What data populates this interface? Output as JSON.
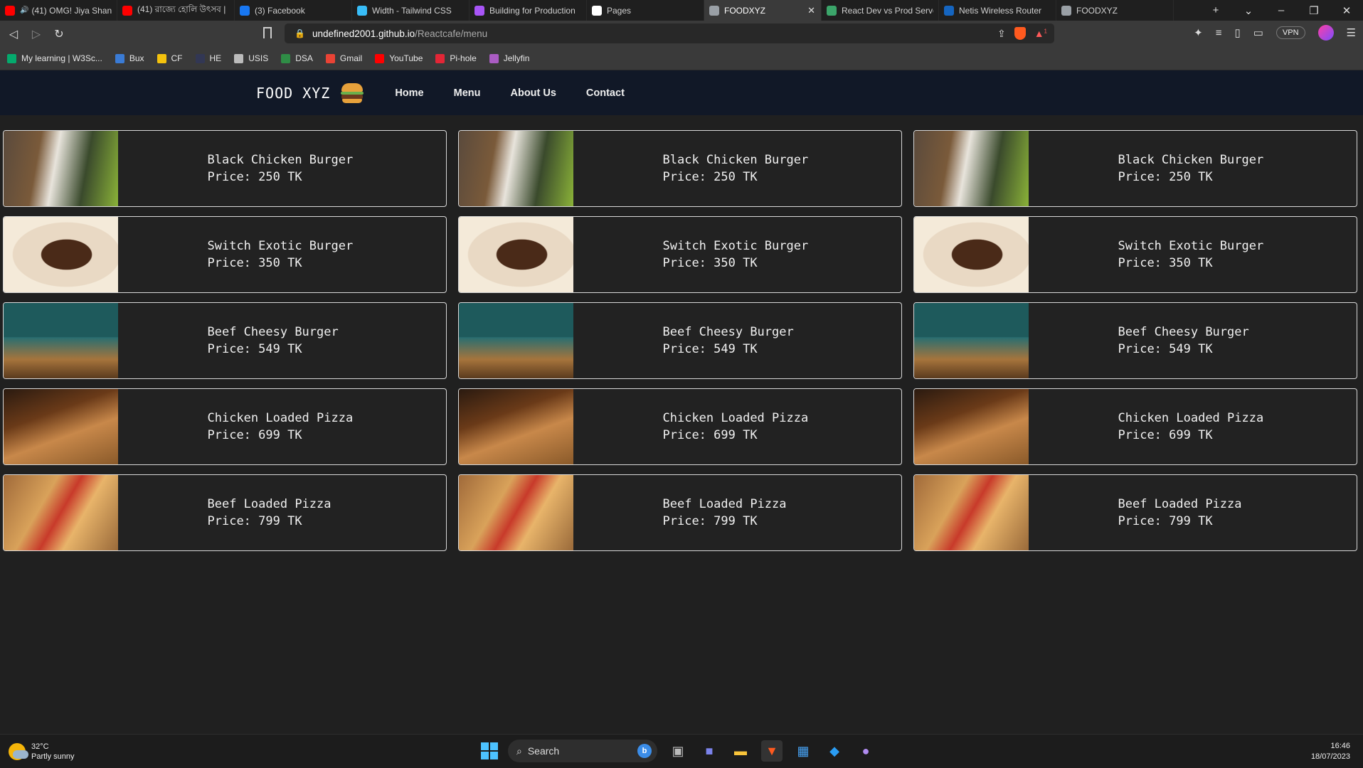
{
  "browser": {
    "tabs": [
      {
        "title": "(41) OMG! Jiya Shan",
        "icon": "youtube-icon",
        "color": "#ff0000",
        "audio": true
      },
      {
        "title": "(41) রাজ্যে হোলি উৎসব |",
        "icon": "youtube-icon",
        "color": "#ff0000"
      },
      {
        "title": "(3) Facebook",
        "icon": "facebook-icon",
        "color": "#1877f2"
      },
      {
        "title": "Width - Tailwind CSS",
        "icon": "tailwind-icon",
        "color": "#38bdf8"
      },
      {
        "title": "Building for Production",
        "icon": "vite-icon",
        "color": "#a855f7"
      },
      {
        "title": "Pages",
        "icon": "github-icon",
        "color": "#ffffff"
      },
      {
        "title": "FOODXYZ",
        "icon": "globe-icon",
        "color": "#9aa0a6",
        "active": true
      },
      {
        "title": "React Dev vs Prod Serve",
        "icon": "stackoverflow-icon",
        "color": "#3ba56a"
      },
      {
        "title": "Netis Wireless Router",
        "icon": "netis-icon",
        "color": "#1565c0"
      },
      {
        "title": "FOODXYZ",
        "icon": "globe-icon",
        "color": "#9aa0a6"
      }
    ],
    "url_host": "undefined2001.github.io",
    "url_path": "/Reactcafe/menu",
    "vpn_label": "VPN",
    "shield_badge": "1",
    "bookmarks": [
      {
        "label": "My learning | W3Sc...",
        "icon": "w3schools-icon",
        "color": "#04aa6d"
      },
      {
        "label": "Bux",
        "icon": "bux-icon",
        "color": "#3a7bd5"
      },
      {
        "label": "CF",
        "icon": "codeforces-icon",
        "color": "#f4c20d"
      },
      {
        "label": "HE",
        "icon": "hackerearth-icon",
        "color": "#323754"
      },
      {
        "label": "USIS",
        "icon": "usis-icon",
        "color": "#bbbbbb"
      },
      {
        "label": "DSA",
        "icon": "dsa-icon",
        "color": "#2f8d46"
      },
      {
        "label": "Gmail",
        "icon": "gmail-icon",
        "color": "#ea4335"
      },
      {
        "label": "YouTube",
        "icon": "youtube-icon",
        "color": "#ff0000"
      },
      {
        "label": "Pi-hole",
        "icon": "pihole-icon",
        "color": "#e32636"
      },
      {
        "label": "Jellyfin",
        "icon": "jellyfin-icon",
        "color": "#aa5cc3"
      }
    ]
  },
  "site": {
    "logo": "FOOD XYZ",
    "nav": [
      "Home",
      "Menu",
      "About Us",
      "Contact"
    ],
    "menu_items": [
      {
        "name": "Black Chicken Burger",
        "price": "Price: 250 TK",
        "image": "black-chicken-burger"
      },
      {
        "name": "Black Chicken Burger",
        "price": "Price: 250 TK",
        "image": "black-chicken-burger"
      },
      {
        "name": "Black Chicken Burger",
        "price": "Price: 250 TK",
        "image": "black-chicken-burger"
      },
      {
        "name": "Switch Exotic Burger",
        "price": "Price: 350 TK",
        "image": "switch-exotic-burger"
      },
      {
        "name": "Switch Exotic Burger",
        "price": "Price: 350 TK",
        "image": "switch-exotic-burger"
      },
      {
        "name": "Switch Exotic Burger",
        "price": "Price: 350 TK",
        "image": "switch-exotic-burger"
      },
      {
        "name": "Beef Cheesy Burger",
        "price": "Price: 549 TK",
        "image": "beef-cheesy-burger"
      },
      {
        "name": "Beef Cheesy Burger",
        "price": "Price: 549 TK",
        "image": "beef-cheesy-burger"
      },
      {
        "name": "Beef Cheesy Burger",
        "price": "Price: 549 TK",
        "image": "beef-cheesy-burger"
      },
      {
        "name": "Chicken Loaded Pizza",
        "price": "Price: 699 TK",
        "image": "chicken-loaded-pizza"
      },
      {
        "name": "Chicken Loaded Pizza",
        "price": "Price: 699 TK",
        "image": "chicken-loaded-pizza"
      },
      {
        "name": "Chicken Loaded Pizza",
        "price": "Price: 699 TK",
        "image": "chicken-loaded-pizza"
      },
      {
        "name": "Beef Loaded Pizza",
        "price": "Price: 799 TK",
        "image": "beef-loaded-pizza"
      },
      {
        "name": "Beef Loaded Pizza",
        "price": "Price: 799 TK",
        "image": "beef-loaded-pizza"
      },
      {
        "name": "Beef Loaded Pizza",
        "price": "Price: 799 TK",
        "image": "beef-loaded-pizza"
      }
    ]
  },
  "taskbar": {
    "weather_temp": "32°C",
    "weather_desc": "Partly sunny",
    "search_placeholder": "Search",
    "time": "16:46",
    "date": "18/07/2023"
  }
}
